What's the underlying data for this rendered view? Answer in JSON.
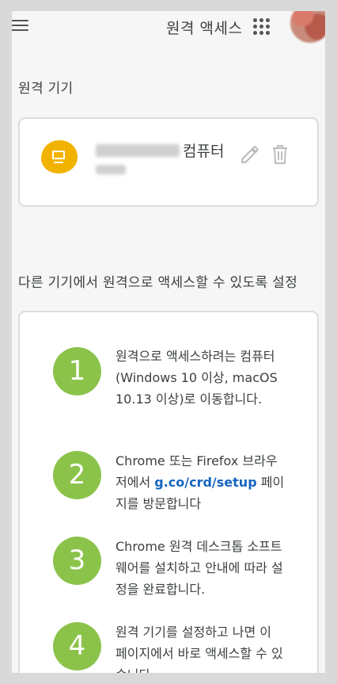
{
  "header": {
    "title": "원격 액세스"
  },
  "devices_section": {
    "heading": "원격 기기",
    "device": {
      "name_suffix": "컴퓨터"
    }
  },
  "setup_section": {
    "heading": "다른 기기에서 원격으로 액세스할 수 있도록 설정",
    "steps": [
      {
        "number": "1",
        "text": "원격으로 액세스하려는 컴퓨터(Windows 10 이상, macOS 10.13 이상)로 이동합니다."
      },
      {
        "number": "2",
        "text_before": "Chrome 또는 Firefox 브라우저에서 ",
        "link": "g.co/crd/setup",
        "text_after": " 페이지를 방문합니다"
      },
      {
        "number": "3",
        "text": "Chrome 원격 데스크톱 소프트웨어를 설치하고 안내에 따라 설정을 완료합니다."
      },
      {
        "number": "4",
        "text": "원격 기기를 설정하고 나면 이 페이지에서 바로 액세스할 수 있습니다."
      }
    ]
  },
  "colors": {
    "step_green": "#8bc34a",
    "device_icon_yellow": "#f2b300",
    "link_blue": "#1565c0"
  }
}
